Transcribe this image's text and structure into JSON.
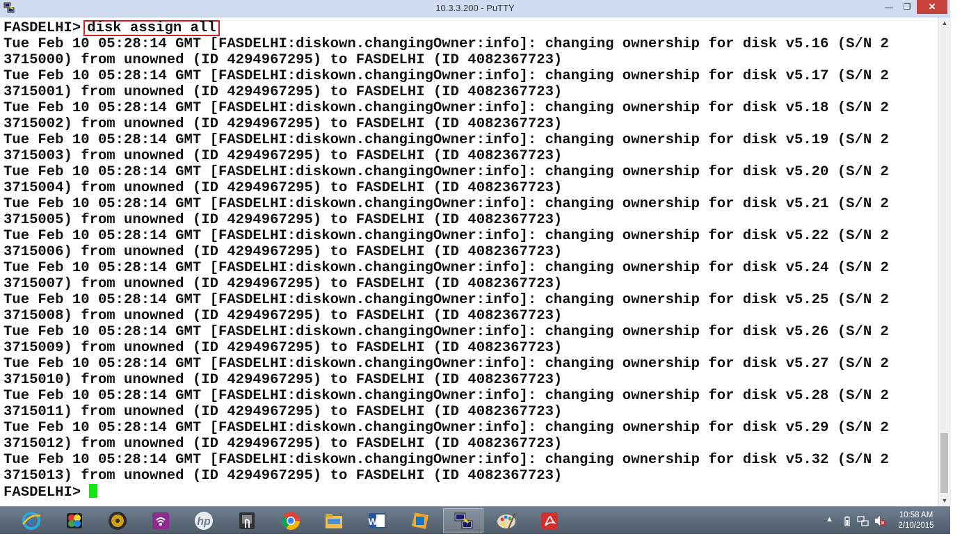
{
  "window": {
    "title": "10.3.3.200 - PuTTY",
    "min_glyph": "—",
    "max_glyph": "❐",
    "close_glyph": "✕"
  },
  "terminal": {
    "prompt": "FASDELHI>",
    "command": "disk assign all",
    "lines": [
      "Tue Feb 10 05:28:14 GMT [FASDELHI:diskown.changingOwner:info]: changing ownership for disk v5.16 (S/N 2",
      "3715000) from unowned (ID 4294967295) to FASDELHI (ID 4082367723)",
      "Tue Feb 10 05:28:14 GMT [FASDELHI:diskown.changingOwner:info]: changing ownership for disk v5.17 (S/N 2",
      "3715001) from unowned (ID 4294967295) to FASDELHI (ID 4082367723)",
      "Tue Feb 10 05:28:14 GMT [FASDELHI:diskown.changingOwner:info]: changing ownership for disk v5.18 (S/N 2",
      "3715002) from unowned (ID 4294967295) to FASDELHI (ID 4082367723)",
      "Tue Feb 10 05:28:14 GMT [FASDELHI:diskown.changingOwner:info]: changing ownership for disk v5.19 (S/N 2",
      "3715003) from unowned (ID 4294967295) to FASDELHI (ID 4082367723)",
      "Tue Feb 10 05:28:14 GMT [FASDELHI:diskown.changingOwner:info]: changing ownership for disk v5.20 (S/N 2",
      "3715004) from unowned (ID 4294967295) to FASDELHI (ID 4082367723)",
      "Tue Feb 10 05:28:14 GMT [FASDELHI:diskown.changingOwner:info]: changing ownership for disk v5.21 (S/N 2",
      "3715005) from unowned (ID 4294967295) to FASDELHI (ID 4082367723)",
      "Tue Feb 10 05:28:14 GMT [FASDELHI:diskown.changingOwner:info]: changing ownership for disk v5.22 (S/N 2",
      "3715006) from unowned (ID 4294967295) to FASDELHI (ID 4082367723)",
      "Tue Feb 10 05:28:14 GMT [FASDELHI:diskown.changingOwner:info]: changing ownership for disk v5.24 (S/N 2",
      "3715007) from unowned (ID 4294967295) to FASDELHI (ID 4082367723)",
      "Tue Feb 10 05:28:14 GMT [FASDELHI:diskown.changingOwner:info]: changing ownership for disk v5.25 (S/N 2",
      "3715008) from unowned (ID 4294967295) to FASDELHI (ID 4082367723)",
      "Tue Feb 10 05:28:14 GMT [FASDELHI:diskown.changingOwner:info]: changing ownership for disk v5.26 (S/N 2",
      "3715009) from unowned (ID 4294967295) to FASDELHI (ID 4082367723)",
      "Tue Feb 10 05:28:14 GMT [FASDELHI:diskown.changingOwner:info]: changing ownership for disk v5.27 (S/N 2",
      "3715010) from unowned (ID 4294967295) to FASDELHI (ID 4082367723)",
      "Tue Feb 10 05:28:14 GMT [FASDELHI:diskown.changingOwner:info]: changing ownership for disk v5.28 (S/N 2",
      "3715011) from unowned (ID 4294967295) to FASDELHI (ID 4082367723)",
      "Tue Feb 10 05:28:14 GMT [FASDELHI:diskown.changingOwner:info]: changing ownership for disk v5.29 (S/N 2",
      "3715012) from unowned (ID 4294967295) to FASDELHI (ID 4082367723)",
      "Tue Feb 10 05:28:14 GMT [FASDELHI:diskown.changingOwner:info]: changing ownership for disk v5.32 (S/N 2",
      "3715013) from unowned (ID 4294967295) to FASDELHI (ID 4082367723)"
    ],
    "final_prompt": "FASDELHI>",
    "colors": {
      "text": "#111111",
      "background": "#ffffff",
      "cursor": "#14e614",
      "highlight_box": "#d21f26"
    }
  },
  "taskbar": {
    "apps": [
      {
        "name": "internet-explorer-icon",
        "active": false
      },
      {
        "name": "photo-app-icon",
        "active": false
      },
      {
        "name": "media-player-icon",
        "active": false
      },
      {
        "name": "wireless-app-icon",
        "active": false
      },
      {
        "name": "hp-icon",
        "active": false
      },
      {
        "name": "touch-app-icon",
        "active": false
      },
      {
        "name": "chrome-icon",
        "active": false
      },
      {
        "name": "file-explorer-icon",
        "active": false
      },
      {
        "name": "word-icon",
        "active": false
      },
      {
        "name": "virtualbox-icon",
        "active": false
      },
      {
        "name": "putty-icon",
        "active": true
      },
      {
        "name": "paint-icon",
        "active": false
      },
      {
        "name": "acrobat-icon",
        "active": false
      }
    ],
    "tray": {
      "show_hidden_glyph": "▲",
      "time": "10:58 AM",
      "date": "2/10/2015"
    }
  }
}
